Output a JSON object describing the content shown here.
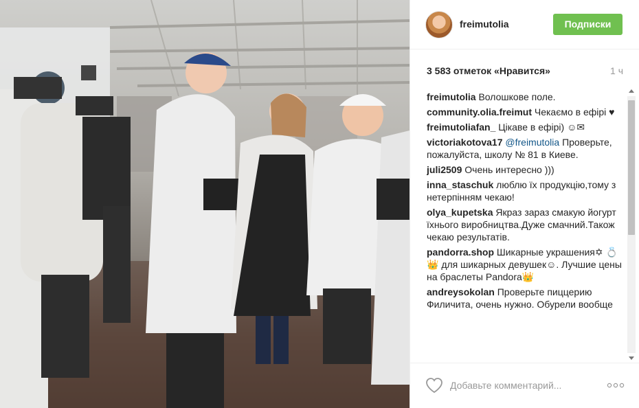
{
  "post": {
    "photo_alt": "",
    "username": "freimutolia",
    "follow_label": "Подписки",
    "likes": "3 583 отметок «Нравится»",
    "time_ago": "1 ч",
    "comments": [
      {
        "user": "freimutolia",
        "text": "Волошкове поле."
      },
      {
        "user": "community.olia.freimut",
        "text": "Чекаємо в ефірі ♥"
      },
      {
        "user": "freimutoliafan_",
        "text": "Цікаве в ефірі) ☺✉"
      },
      {
        "user": "victoriakotova17",
        "mention": "@freimutolia",
        "text": "Проверьте, пожалуйста, школу № 81 в Киеве."
      },
      {
        "user": "juli2509",
        "text": "Очень интересно )))"
      },
      {
        "user": "inna_staschuk",
        "text": "люблю їх продукцію,тому з нетерпінням чекаю!"
      },
      {
        "user": "olya_kupetska",
        "text": "Якраз зараз смакую йогурт їхнього виробництва.Дуже смачний.Також чекаю результатів."
      },
      {
        "user": "pandorra.shop",
        "text": "Шикарные украшения✡ 💍👑 для шикарных девушек☺. Лучшие цены на браслеты Pandora👑"
      },
      {
        "user": "andreysokolan",
        "text": "Проверьте пиццерию Филичита, очень нужно. Обурели вообще"
      }
    ],
    "add_comment_placeholder": "Добавьте комментарий...",
    "more_glyph": "○○○"
  },
  "colors": {
    "follow_button": "#70c050",
    "mention": "#125688",
    "muted": "#999999"
  },
  "icons": {
    "like": "heart-outline-icon",
    "options": "more-options-icon"
  }
}
